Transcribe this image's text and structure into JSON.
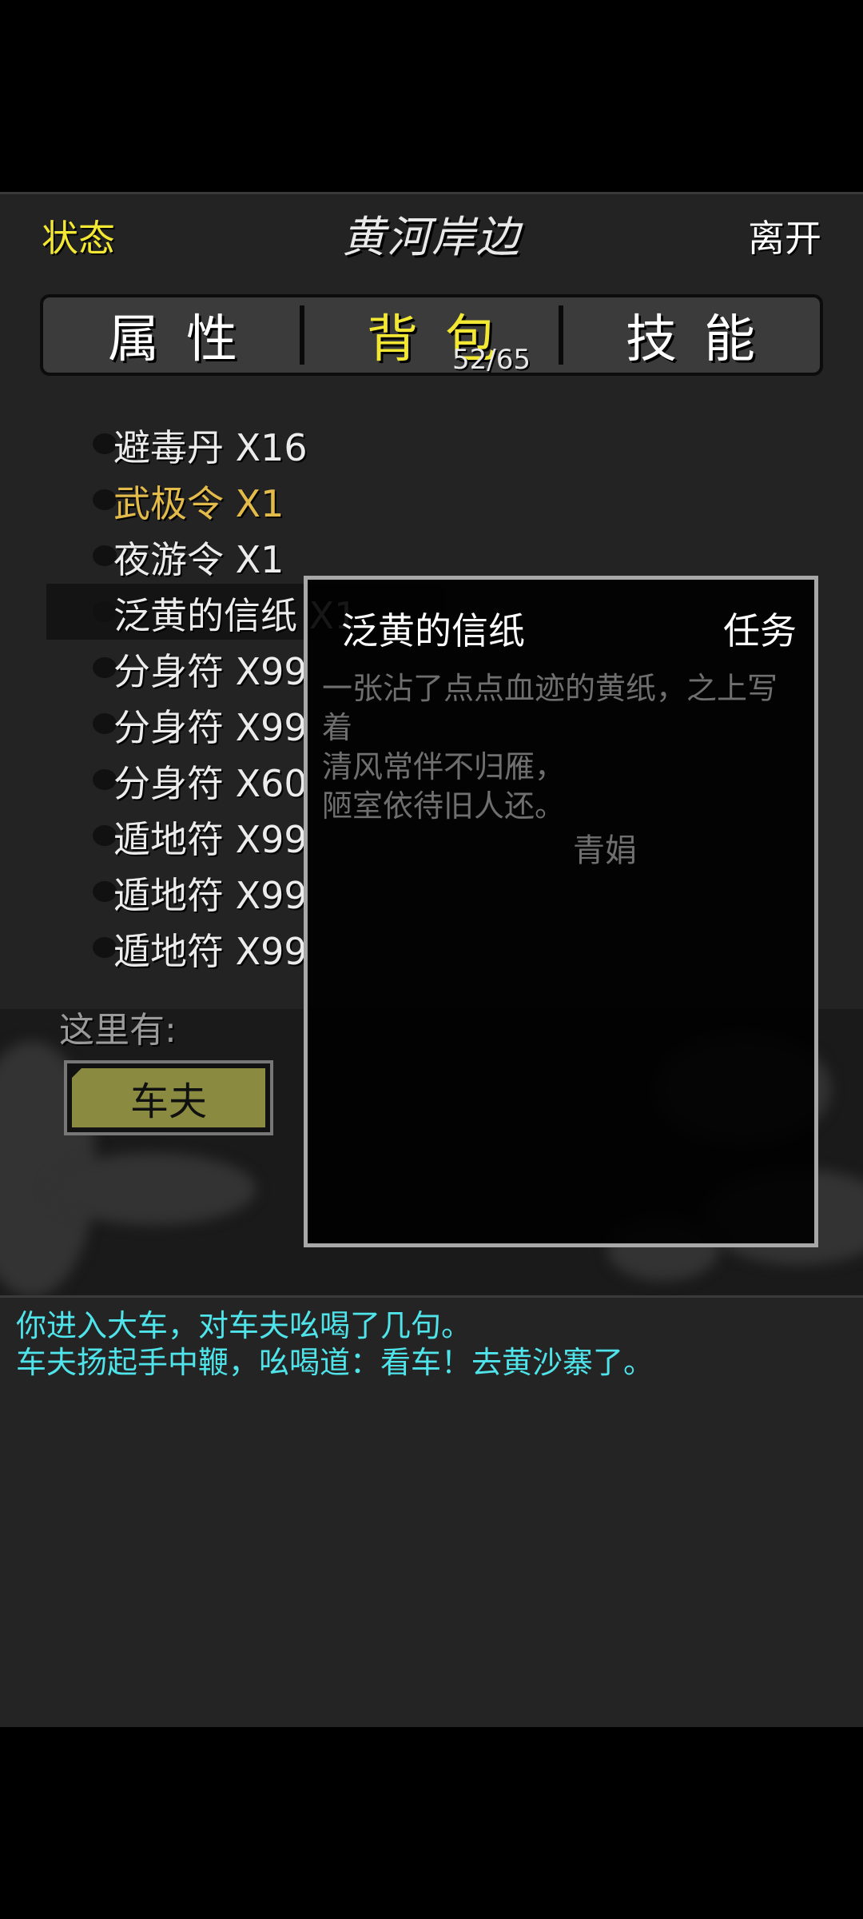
{
  "header": {
    "status_label": "状态",
    "location_title": "黄河岸边",
    "leave_label": "离开"
  },
  "tabs": [
    {
      "label": "属性",
      "active": false
    },
    {
      "label": "背包",
      "active": true
    },
    {
      "label": "技能",
      "active": false
    }
  ],
  "bag_count": "52/65",
  "items": [
    {
      "label": "避毒丹 X16",
      "color": "normal"
    },
    {
      "label": "武极令 X1",
      "color": "gold"
    },
    {
      "label": "夜游令 X1",
      "color": "normal"
    },
    {
      "label": "泛黄的信纸 X1",
      "color": "normal",
      "selected": true
    },
    {
      "label": "分身符 X99",
      "color": "normal"
    },
    {
      "label": "分身符 X99",
      "color": "normal"
    },
    {
      "label": "分身符 X60",
      "color": "normal"
    },
    {
      "label": "遁地符 X99",
      "color": "normal"
    },
    {
      "label": "遁地符 X99",
      "color": "normal"
    },
    {
      "label": "遁地符 X99",
      "color": "normal"
    }
  ],
  "scene": {
    "here_label": "这里有:",
    "npc_label": "车夫"
  },
  "popup": {
    "item_name": "泛黄的信纸",
    "item_type": "任务",
    "description_lines": [
      "一张沾了点点血迹的黄纸，之上写着",
      "清风常伴不归雁，",
      "陋室依待旧人还。"
    ],
    "signature": "青娟"
  },
  "log": [
    "你进入大车，对车夫吆喝了几句。",
    "车夫扬起手中鞭，吆喝道：看车！去黄沙寨了。"
  ],
  "colors": {
    "active_tab": "#f2e833",
    "gold_item": "#e3bb4a",
    "log_text": "#4fe3ea",
    "npc_button": "#8a8a40"
  }
}
